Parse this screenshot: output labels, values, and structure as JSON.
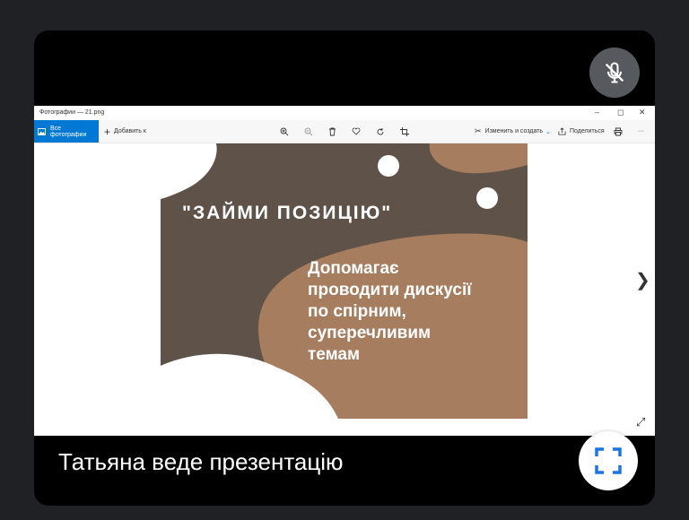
{
  "window": {
    "title": "Фотографии — 21.png",
    "minimize": "–",
    "restore": "◻",
    "close": "✕"
  },
  "toolbar": {
    "all_photos": "Все фотографии",
    "add": "Добавить к",
    "edit_create": "Изменить и создать",
    "share": "Поделиться",
    "more": "···"
  },
  "slide": {
    "title": "\"ЗАЙМИ ПОЗИЦІЮ\"",
    "body": [
      "Допомагає",
      "проводити дискусії",
      "по спірним,",
      "суперечливим",
      "темам"
    ]
  },
  "meeting": {
    "presenter_caption": "Татьяна веде презентацію"
  },
  "colors": {
    "slide_bg": "#5f5349",
    "slide_accent": "#a67d5e",
    "accent_blue": "#0078d4",
    "fullscreen_icon": "#1a73e8"
  }
}
